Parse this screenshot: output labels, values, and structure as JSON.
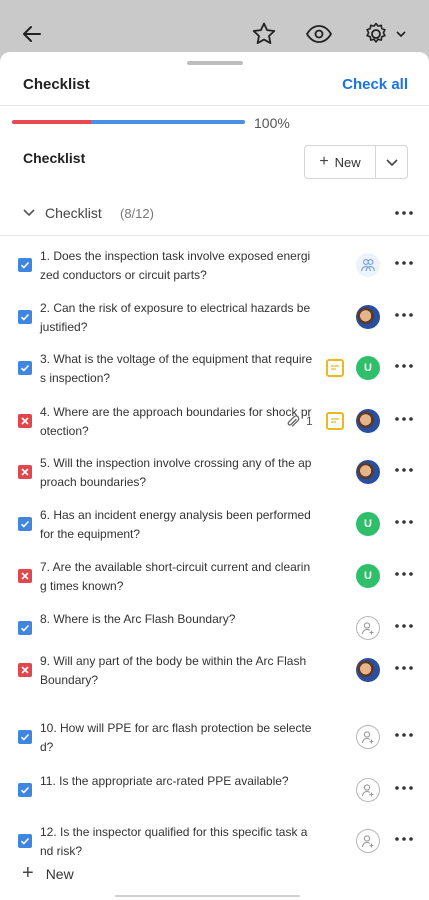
{
  "toolbar": {
    "back_icon": "arrow-left-icon",
    "star_icon": "star-icon",
    "eye_icon": "eye-icon",
    "settings_icon": "gear-icon"
  },
  "header": {
    "title": "Checklist",
    "check_all": "Check all"
  },
  "progress": {
    "percent_label": "100%",
    "fraction": 1.0,
    "red_fraction": 0.34,
    "colors": {
      "red": "#e8484f",
      "blue": "#4a8fe7"
    }
  },
  "section": {
    "title": "Checklist",
    "new_label": "New"
  },
  "group": {
    "title": "Checklist",
    "count": "(8/12)"
  },
  "items": [
    {
      "text": "1. Does the inspection task involve exposed energized conductors or circuit parts?",
      "status": "done",
      "assignee": "group"
    },
    {
      "text": "2. Can the risk of exposure to electrical hazards be justified?",
      "status": "done",
      "assignee": "photo"
    },
    {
      "text": "3. What is the voltage of the equipment that requires inspection?",
      "status": "done",
      "flag": true,
      "assignee": "U"
    },
    {
      "text": "4. Where are the approach boundaries for shock protection?",
      "status": "fail",
      "attachments": "1",
      "flag": true,
      "assignee": "photo"
    },
    {
      "text": "5. Will the inspection involve crossing any of the approach boundaries?",
      "status": "fail",
      "assignee": "photo"
    },
    {
      "text": "6. Has an incident energy analysis been performed for the equipment?",
      "status": "done",
      "assignee": "U"
    },
    {
      "text": "7. Are the available short-circuit current and clearing times known?",
      "status": "fail",
      "assignee": "U"
    },
    {
      "text": "8. Where is the Arc Flash Boundary?",
      "status": "done",
      "assignee": "empty"
    },
    {
      "text": "9. Will any part of the body be within the Arc Flash Boundary?",
      "status": "fail",
      "assignee": "photo"
    },
    {
      "text": "10. How will PPE for arc flash protection be selected?",
      "status": "done",
      "assignee": "empty"
    },
    {
      "text": "11. Is the appropriate arc-rated PPE available?",
      "status": "done",
      "assignee": "empty"
    },
    {
      "text": "12. Is the inspector qualified for this specific task and risk?",
      "status": "done",
      "assignee": "empty"
    }
  ],
  "footer": {
    "new_label": "New"
  }
}
